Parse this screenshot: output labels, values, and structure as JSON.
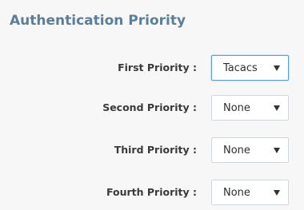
{
  "section": {
    "title": "Authentication Priority"
  },
  "priorities": [
    {
      "label": "First Priority :",
      "value": "Tacacs"
    },
    {
      "label": "Second Priority :",
      "value": "None"
    },
    {
      "label": "Third Priority :",
      "value": "None"
    },
    {
      "label": "Fourth Priority :",
      "value": "None"
    }
  ],
  "icons": {
    "dropdown": "caret-down-icon"
  },
  "colors": {
    "title": "#5e7d97",
    "focus_border": "#5b9fd6",
    "background": "#f7f7f7"
  }
}
